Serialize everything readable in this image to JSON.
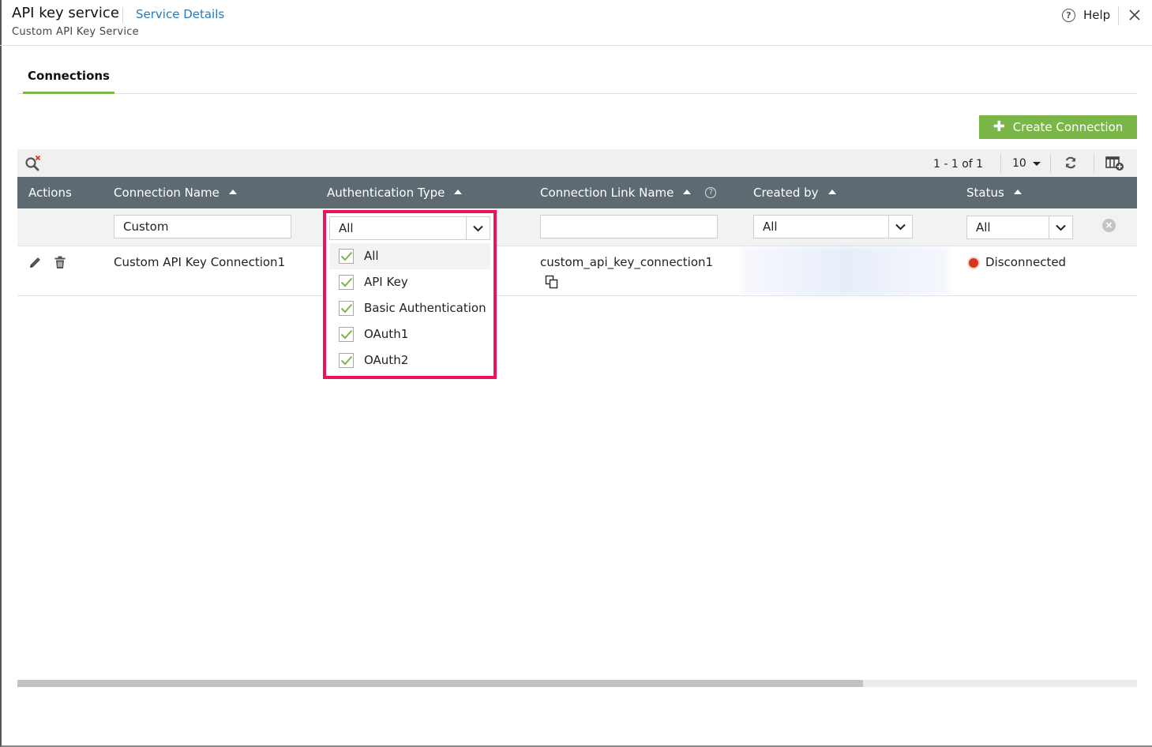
{
  "header": {
    "title": "API key service",
    "service_details_link": "Service Details",
    "subtitle": "Custom API Key Service",
    "help_label": "Help"
  },
  "tabs": [
    {
      "label": "Connections",
      "active": true
    }
  ],
  "toolbar": {
    "create_button_label": "Create Connection",
    "pagination": "1 - 1 of 1",
    "per_page": "10"
  },
  "table": {
    "columns": [
      {
        "label": "Actions"
      },
      {
        "label": "Connection Name"
      },
      {
        "label": "Authentication Type"
      },
      {
        "label": "Connection Link Name"
      },
      {
        "label": "Created by"
      },
      {
        "label": "Status"
      }
    ],
    "filters": {
      "connection_name": "Custom",
      "authentication_type": "All",
      "connection_link_name": "",
      "created_by": "All",
      "status": "All"
    },
    "rows": [
      {
        "connection_name": "Custom API Key Connection1",
        "connection_link_name": "custom_api_key_connection1",
        "status": "Disconnected"
      }
    ]
  },
  "auth_dropdown": {
    "selected": "All",
    "options": [
      {
        "label": "All",
        "checked": true
      },
      {
        "label": "API Key",
        "checked": true
      },
      {
        "label": "Basic Authentication",
        "checked": true
      },
      {
        "label": "OAuth1",
        "checked": true
      },
      {
        "label": "OAuth2",
        "checked": true
      }
    ]
  },
  "colors": {
    "accent_green": "#7ab648",
    "header_bar": "#5e6a72",
    "highlight_border": "#ec1458",
    "link_blue": "#2a7ab8",
    "status_disconnected": "#d6361f"
  },
  "icons": [
    "help-icon",
    "close-icon",
    "search-clear-icon",
    "refresh-icon",
    "column-settings-icon",
    "edit-icon",
    "delete-icon",
    "copy-icon",
    "clear-filter-icon",
    "chevron-down-icon",
    "check-icon"
  ]
}
